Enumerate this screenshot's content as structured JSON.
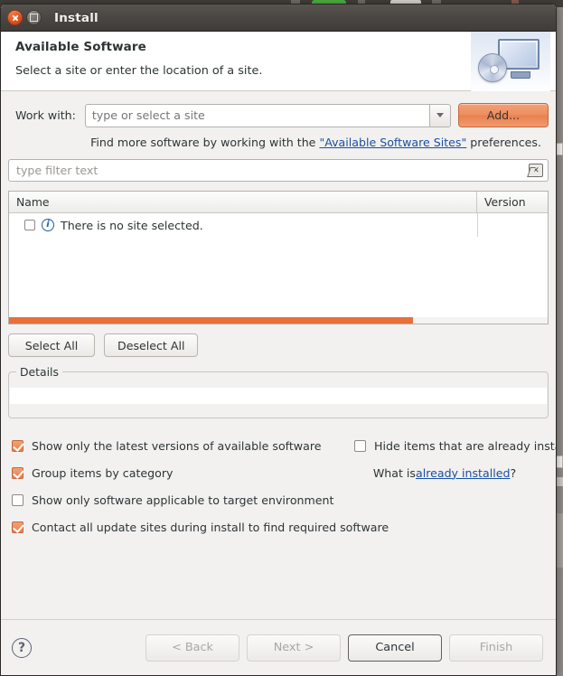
{
  "window": {
    "title": "Install",
    "close_icon": "close-icon",
    "maximize_icon": "maximize-icon"
  },
  "header": {
    "title": "Available Software",
    "subtitle": "Select a site or enter the location of a site.",
    "image_icon": "install-monitor-cd-icon"
  },
  "work_with": {
    "label": "Work with:",
    "value": "",
    "placeholder": "type or select a site",
    "dropdown_icon": "chevron-down-icon",
    "add_button": "Add..."
  },
  "hint": {
    "prefix": "Find more software by working with the ",
    "link": "\"Available Software Sites\"",
    "suffix": " preferences."
  },
  "filter": {
    "placeholder": "type filter text",
    "value": "",
    "clear_icon": "clear-icon"
  },
  "table": {
    "columns": [
      "Name",
      "Version"
    ],
    "rows": [
      {
        "checked": false,
        "icon": "info-icon",
        "name": "There is no site selected.",
        "version": ""
      }
    ],
    "scrollbar": {
      "orientation": "horizontal",
      "thumb_percent": 75,
      "color": "#e8703a"
    }
  },
  "selection_buttons": {
    "select_all": "Select All",
    "deselect_all": "Deselect All"
  },
  "details": {
    "title": "Details",
    "content": ""
  },
  "options": {
    "left": [
      {
        "label": "Show only the latest versions of available software",
        "checked": true
      },
      {
        "label": "Group items by category",
        "checked": true
      },
      {
        "label": "Show only software applicable to target environment",
        "checked": false
      },
      {
        "label": "Contact all update sites during install to find required software",
        "checked": true
      }
    ],
    "right": {
      "hide_installed": {
        "label": "Hide items that are already installed",
        "checked": false
      },
      "what_is_prefix": "What is ",
      "what_is_link": "already installed",
      "what_is_suffix": "?"
    }
  },
  "footer": {
    "help_icon": "help-icon",
    "buttons": [
      {
        "label": "< Back",
        "enabled": false
      },
      {
        "label": "Next >",
        "enabled": false
      },
      {
        "label": "Cancel",
        "enabled": true
      },
      {
        "label": "Finish",
        "enabled": false
      }
    ]
  },
  "colors": {
    "accent": "#e8703a",
    "link": "#1a4fa0",
    "titlebar": "#4a4643",
    "dialog_bg": "#f2f1f0"
  }
}
